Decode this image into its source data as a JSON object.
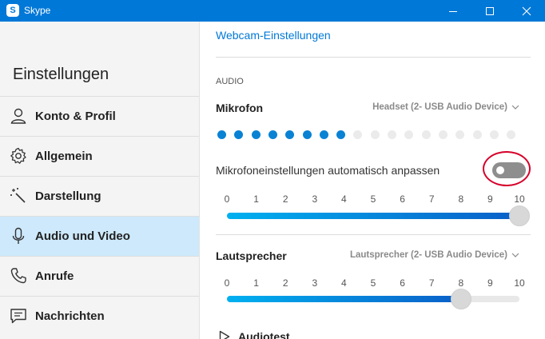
{
  "window": {
    "title": "Skype",
    "app_icon_letter": "S",
    "accent_color": "#0078d7"
  },
  "sidebar": {
    "title": "Einstellungen",
    "items": [
      {
        "label": "Konto & Profil",
        "icon": "person-icon",
        "active": false
      },
      {
        "label": "Allgemein",
        "icon": "gear-icon",
        "active": false
      },
      {
        "label": "Darstellung",
        "icon": "magic-wand-icon",
        "active": false
      },
      {
        "label": "Audio und Video",
        "icon": "microphone-icon",
        "active": true
      },
      {
        "label": "Anrufe",
        "icon": "phone-icon",
        "active": false
      },
      {
        "label": "Nachrichten",
        "icon": "message-icon",
        "active": false
      }
    ]
  },
  "content": {
    "webcam_link": "Webcam-Einstellungen",
    "audio_section_label": "AUDIO",
    "microphone": {
      "title": "Mikrofon",
      "device": "Headset (2- USB Audio Device)",
      "level_dots_total": 18,
      "level_dots_active": 8,
      "auto_adjust_label": "Mikrofoneinstellungen automatisch anpassen",
      "auto_adjust_enabled": false,
      "volume_ticks": [
        "0",
        "1",
        "2",
        "3",
        "4",
        "5",
        "6",
        "7",
        "8",
        "9",
        "10"
      ],
      "volume_value": 10
    },
    "speaker": {
      "title": "Lautsprecher",
      "device": "Lautsprecher (2- USB Audio Device)",
      "volume_ticks": [
        "0",
        "1",
        "2",
        "3",
        "4",
        "5",
        "6",
        "7",
        "8",
        "9",
        "10"
      ],
      "volume_value": 8
    },
    "audiotest_label": "Audiotest"
  }
}
